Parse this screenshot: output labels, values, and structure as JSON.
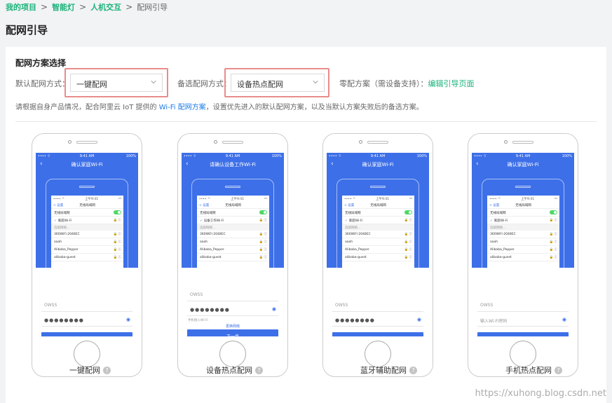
{
  "breadcrumb": [
    "我的项目",
    "智能灯",
    "人机交互",
    "配网引导"
  ],
  "page_title": "配网引导",
  "section_title": "配网方案选择",
  "default_method": {
    "label": "默认配网方式：",
    "value": "一键配网"
  },
  "backup_method": {
    "label": "备选配网方式：",
    "value": "设备热点配网"
  },
  "zero_config": {
    "label": "零配方案（需设备支持）：",
    "link": "编辑引导页面"
  },
  "description": {
    "pre": "请根据自身产品情况，配合阿里云 IoT 提供的 ",
    "link": "Wi-Fi 配网方案",
    "post": "，设置优先进入的默认配网方案，以及当默认方案失败后的备选方案。"
  },
  "phones": [
    {
      "caption": "一键配网",
      "screen_title": "确认家庭Wi-Fi",
      "status_time": "9:41 AM",
      "status_battery": "100%",
      "mini_title": "无线局域网",
      "mini_back": "< 设置",
      "mini_time": "上午9:41",
      "wlan_label": "无线局域网",
      "connected": "家庭Wi-Fi",
      "choose": "选取网络...",
      "networks": [
        "360WiFi-2048EC",
        "aaah",
        "Alibaba_Pepper",
        "alibaba-guest"
      ],
      "field1": "OWSS",
      "field2_dots": "●●●●●●●●",
      "hint": "",
      "sublink": "",
      "button": "下一步"
    },
    {
      "caption": "设备热点配网",
      "screen_title": "请确认设备工作Wi-Fi",
      "status_time": "9:41 AM",
      "status_battery": "100%",
      "mini_title": "无线局域网",
      "mini_back": "< 设置",
      "mini_time": "上午9:41",
      "wlan_label": "无线局域网",
      "connected": "设备工作Wi-Fi",
      "choose": "选取网络...",
      "networks": [
        "360WiFi-2048EC",
        "aaah",
        "Alibaba_Pepper",
        "alibaba-guest"
      ],
      "field1": "OWSS",
      "field2_dots": "●●●●●●●●",
      "hint": "手机接入Wi-Fi",
      "sublink": "更换网络",
      "button": "下一步"
    },
    {
      "caption": "蓝牙辅助配网",
      "screen_title": "确认家庭Wi-Fi",
      "status_time": "9:41 AM",
      "status_battery": "100%",
      "mini_title": "无线局域网",
      "mini_back": "< 设置",
      "mini_time": "上午9:41",
      "wlan_label": "无线局域网",
      "connected": "家庭Wi-Fi",
      "choose": "选取网络...",
      "networks": [
        "360WiFi-2048EC",
        "aaah",
        "Alibaba_Pepper",
        "alibaba-guest"
      ],
      "field1": "OWSS",
      "field2_dots": "●●●●●●●●",
      "hint": "",
      "sublink": "",
      "button": "下一步"
    },
    {
      "caption": "手机热点配网",
      "screen_title": "确认家庭Wi-Fi",
      "status_time": "9:41 AM",
      "status_battery": "100%",
      "mini_title": "无线局域网",
      "mini_back": "< 设置",
      "mini_time": "上午9:41",
      "wlan_label": "无线局域网",
      "connected": "家庭Wi-Fi",
      "choose": "选取网络...",
      "networks": [
        "360WiFi-2048EC",
        "aaah",
        "Alibaba_Pepper",
        "alibaba-guest"
      ],
      "field1": "OWSS",
      "field2_placeholder": "输入Wi-Fi密码",
      "hint": "",
      "sublink": "",
      "button": "下一步"
    }
  ],
  "watermark": "https://xuhong.blog.csdn.net"
}
